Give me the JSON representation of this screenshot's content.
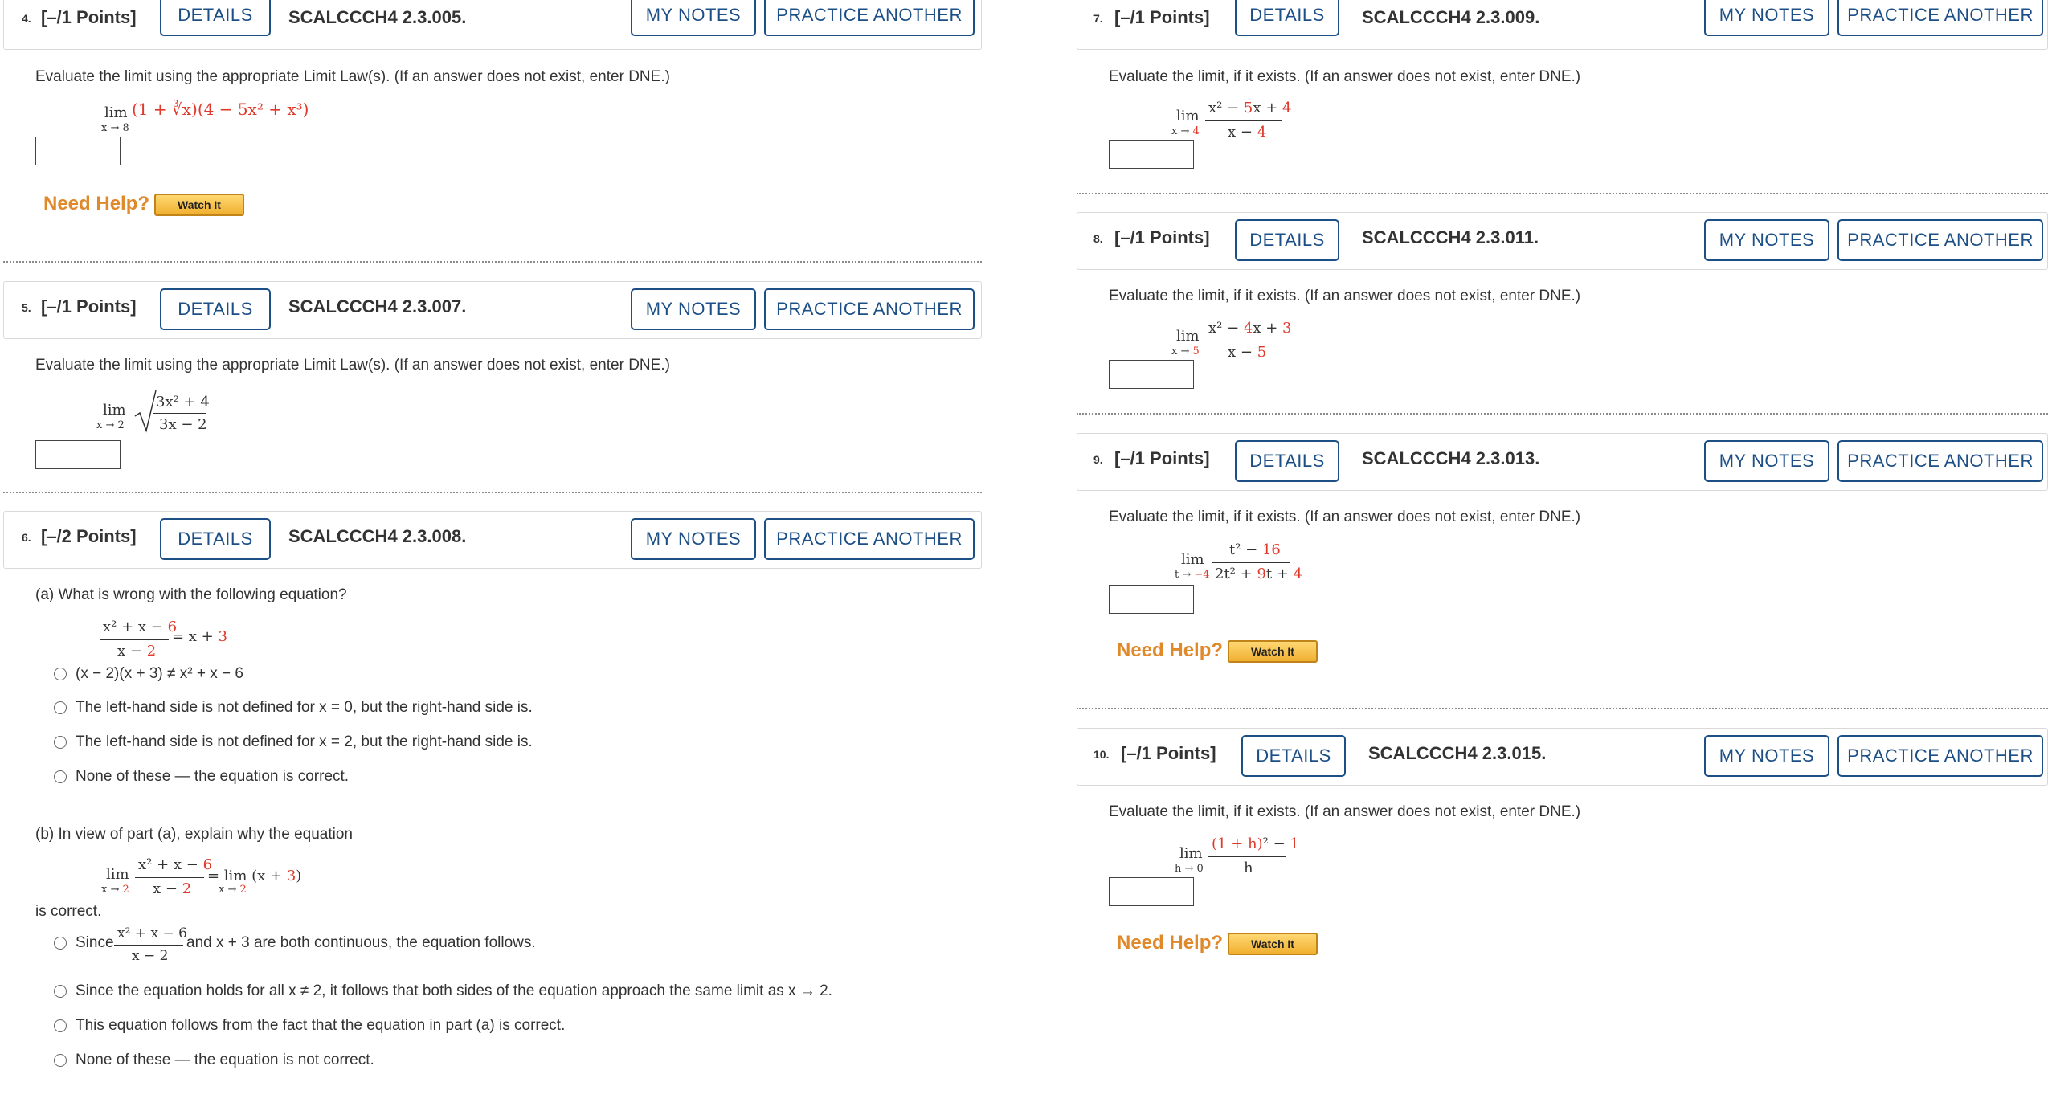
{
  "buttons": {
    "details": "DETAILS",
    "my_notes": "MY NOTES",
    "practice": "PRACTICE ANOTHER"
  },
  "need_help": "Need Help?",
  "watch_it": "Watch It",
  "lim": "lim",
  "q4": {
    "num": "4.",
    "points": "[–/1 Points]",
    "code": "SCALCCCH4 2.3.005.",
    "prompt": "Evaluate the limit using the appropriate Limit Law(s). (If an answer does not exist, enter DNE.)",
    "sub": "x → 8",
    "expr_a": "(1 + ∛x)",
    "expr_b": "(4 − 5x² + x³)"
  },
  "q5": {
    "num": "5.",
    "points": "[–/1 Points]",
    "code": "SCALCCCH4 2.3.007.",
    "prompt": "Evaluate the limit using the appropriate Limit Law(s). (If an answer does not exist, enter DNE.)",
    "sub": "x → 2",
    "numer": "3x² + 4",
    "denom": "3x − 2"
  },
  "q6": {
    "num": "6.",
    "points": "[–/2 Points]",
    "code": "SCALCCCH4 2.3.008.",
    "part_a": "(a) What is wrong with the following equation?",
    "eq_numer": "x² + x − 6",
    "eq_denom": "x − 2",
    "eq_rhs": "= x + 3",
    "options_a": [
      "(x − 2)(x + 3) ≠ x² + x − 6",
      "The left-hand side is not defined for x = 0, but the right-hand side is.",
      "The left-hand side is not defined for x = 2, but the right-hand side is.",
      "None of these — the equation is correct."
    ],
    "part_b": "(b) In view of part (a), explain why the equation",
    "eqb_sub": "x → 2",
    "eqb_rhs": "= lim (x + 3)",
    "is_correct": "is correct.",
    "options_b": [
      "Since",
      "and x + 3 are both continuous, the equation follows.",
      "Since the equation holds for all x ≠ 2, it follows that both sides of the equation approach the same limit as x → 2.",
      "This equation follows from the fact that the equation in part (a) is correct.",
      "None of these — the equation is not correct."
    ]
  },
  "q7": {
    "num": "7.",
    "points": "[–/1 Points]",
    "code": "SCALCCCH4 2.3.009.",
    "prompt": "Evaluate the limit, if it exists. (If an answer does not exist, enter DNE.)",
    "sub": "x → 4",
    "numer": "x² − 5x + 4",
    "denom": "x − 4"
  },
  "q8": {
    "num": "8.",
    "points": "[–/1 Points]",
    "code": "SCALCCCH4 2.3.011.",
    "prompt": "Evaluate the limit, if it exists. (If an answer does not exist, enter DNE.)",
    "sub": "x → 5",
    "numer": "x² − 4x + 3",
    "denom": "x − 5"
  },
  "q9": {
    "num": "9.",
    "points": "[–/1 Points]",
    "code": "SCALCCCH4 2.3.013.",
    "prompt": "Evaluate the limit, if it exists. (If an answer does not exist, enter DNE.)",
    "sub": "t → −4",
    "numer": "t² − 16",
    "denom": "2t² + 9t + 4"
  },
  "q10": {
    "num": "10.",
    "points": "[–/1 Points]",
    "code": "SCALCCCH4 2.3.015.",
    "prompt": "Evaluate the limit, if it exists. (If an answer does not exist, enter DNE.)",
    "sub": "h → 0",
    "numer": "(1 + h)² − 1",
    "denom": "h"
  },
  "colors": {
    "accent": "#1d4f87",
    "help": "#e0892b",
    "red": "#e0392b"
  }
}
